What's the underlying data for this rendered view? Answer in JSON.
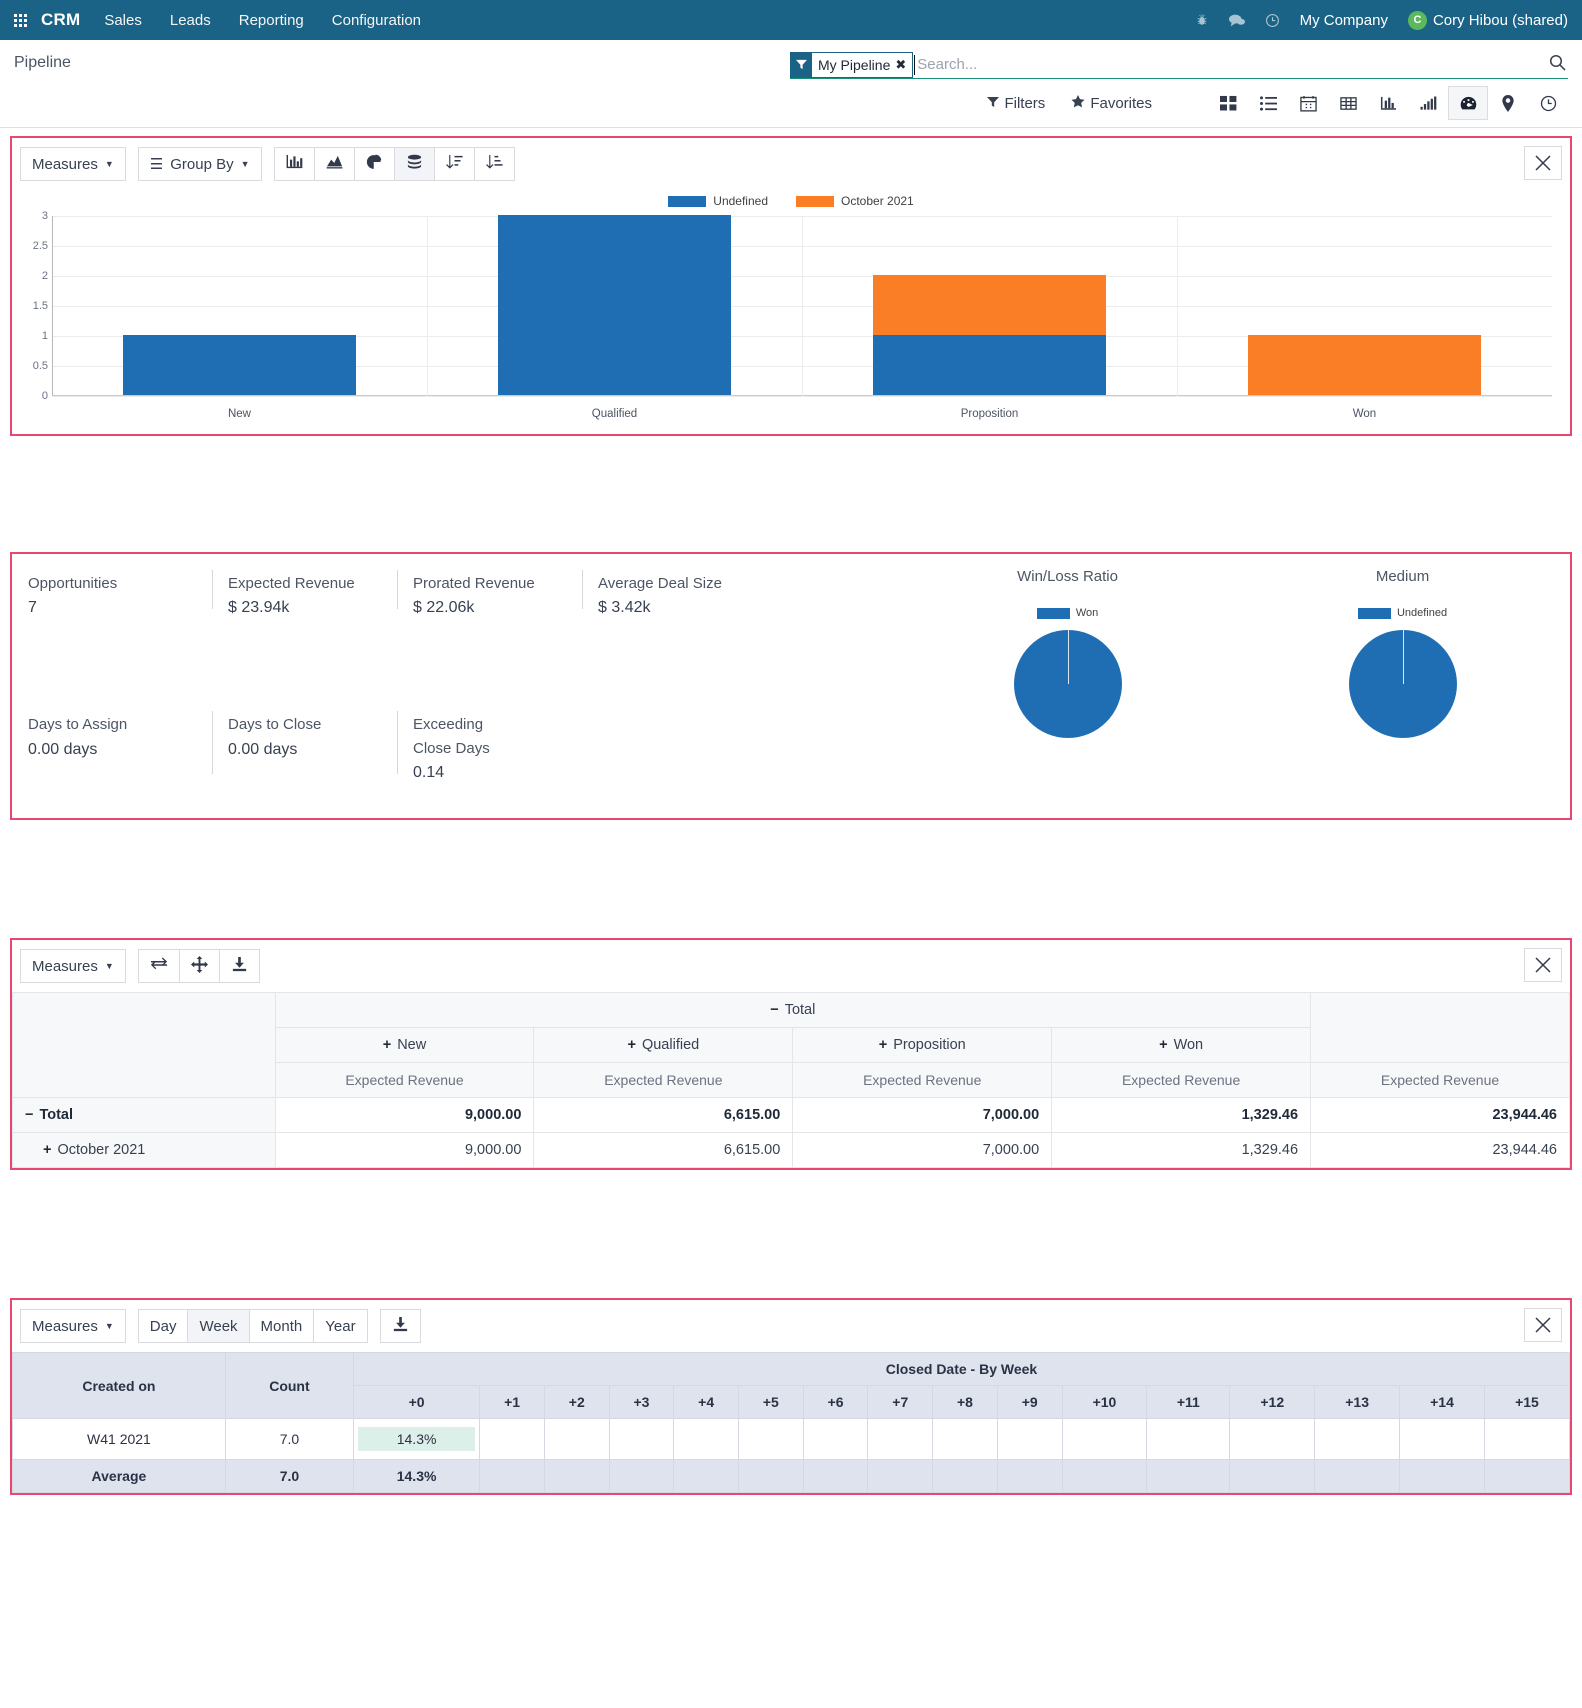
{
  "navbar": {
    "apps_icon": "grid-apps-icon",
    "brand": "CRM",
    "items": [
      "Sales",
      "Leads",
      "Reporting",
      "Configuration"
    ],
    "icons": [
      "bug-icon",
      "messages-icon",
      "activity-clock-icon"
    ],
    "company": "My Company",
    "user": "Cory Hibou (shared)",
    "avatar_letter": "C",
    "avatar_color": "#5cb85c",
    "bg_color": "#1a6387"
  },
  "control_panel": {
    "title": "Pipeline",
    "facet": {
      "label": "My Pipeline",
      "remove": "✖",
      "icon": "filter-icon"
    },
    "search_placeholder": "Search...",
    "search_value": "",
    "search_icon": "magnifier-icon",
    "filters_label": "Filters",
    "favorites_label": "Favorites",
    "views": [
      {
        "name": "kanban-view",
        "icon": "kanban-icon",
        "active": false
      },
      {
        "name": "list-view",
        "icon": "list-icon",
        "active": false
      },
      {
        "name": "calendar-view",
        "icon": "calendar-icon",
        "active": false
      },
      {
        "name": "pivot-view",
        "icon": "table-icon",
        "active": false
      },
      {
        "name": "graph-view",
        "icon": "bar-chart-icon",
        "active": false
      },
      {
        "name": "cohort-view",
        "icon": "signal-bars-icon",
        "active": false
      },
      {
        "name": "dashboard-view",
        "icon": "dashboard-gauge-icon",
        "active": true
      },
      {
        "name": "map-view",
        "icon": "map-pin-icon",
        "active": false
      },
      {
        "name": "activity-view",
        "icon": "clock-icon",
        "active": false
      }
    ]
  },
  "graph_panel": {
    "measures_label": "Measures",
    "group_by_label": "Group By",
    "buttons": [
      {
        "name": "bar-chart-button",
        "icon": "bar-chart-icon",
        "active": false
      },
      {
        "name": "line-chart-button",
        "icon": "area-chart-icon",
        "active": false
      },
      {
        "name": "pie-chart-button",
        "icon": "pie-chart-icon",
        "active": false
      },
      {
        "name": "stacked-button",
        "icon": "database-stack-icon",
        "active": true
      },
      {
        "name": "sort-descending-button",
        "icon": "sort-desc-icon",
        "active": false
      },
      {
        "name": "sort-ascending-button",
        "icon": "sort-asc-icon",
        "active": false
      }
    ],
    "expand_icon": "expand-icon"
  },
  "chart_data": {
    "type": "bar",
    "stacked": true,
    "title": "",
    "xlabel": "",
    "ylabel": "",
    "categories": [
      "New",
      "Qualified",
      "Proposition",
      "Won"
    ],
    "series": [
      {
        "name": "Undefined",
        "color": "#1f6eb4",
        "values": [
          1,
          3,
          1,
          0
        ]
      },
      {
        "name": "October 2021",
        "color": "#fa7e25",
        "values": [
          0,
          0,
          1,
          1
        ]
      }
    ],
    "ylim": [
      0,
      3
    ],
    "yticks": [
      "0",
      "0.5",
      "1",
      "1.5",
      "2",
      "2.5",
      "3"
    ],
    "grid": true,
    "legend_position": "top"
  },
  "kpi_panel": {
    "cells": [
      {
        "name": "Opportunities",
        "value": "7"
      },
      {
        "name": "Expected Revenue",
        "value": "$ 23.94k"
      },
      {
        "name": "Prorated Revenue",
        "value": "$ 22.06k"
      },
      {
        "name": "Average Deal Size",
        "value": "$ 3.42k"
      },
      {
        "name": "Days to Assign",
        "value": "0.00 days"
      },
      {
        "name": "Days to Close",
        "value": "0.00 days"
      },
      {
        "name": "Exceeding Close Days",
        "value": "0.14"
      }
    ],
    "pies": [
      {
        "title": "Win/Loss Ratio",
        "legend": "Won",
        "color": "#1f6eb4"
      },
      {
        "title": "Medium",
        "legend": "Undefined",
        "color": "#1f6eb4"
      }
    ]
  },
  "pivot_panel": {
    "measures_label": "Measures",
    "buttons": [
      {
        "name": "flip-axis-button",
        "icon": "swap-arrows-icon"
      },
      {
        "name": "expand-all-button",
        "icon": "move-arrows-icon"
      },
      {
        "name": "download-xlsx-button",
        "icon": "download-icon"
      }
    ],
    "expand_icon": "expand-icon",
    "total_header": "Total",
    "col_groups": [
      "New",
      "Qualified",
      "Proposition",
      "Won"
    ],
    "measure_label": "Expected Revenue",
    "rows": [
      {
        "label": "Total",
        "toggle": "−",
        "indent": false,
        "bold": true,
        "values": [
          "9,000.00",
          "6,615.00",
          "7,000.00",
          "1,329.46",
          "23,944.46"
        ]
      },
      {
        "label": "October 2021",
        "toggle": "+",
        "indent": true,
        "bold": false,
        "values": [
          "9,000.00",
          "6,615.00",
          "7,000.00",
          "1,329.46",
          "23,944.46"
        ]
      }
    ]
  },
  "cohort_panel": {
    "measures_label": "Measures",
    "intervals": [
      {
        "label": "Day",
        "active": false
      },
      {
        "label": "Week",
        "active": true
      },
      {
        "label": "Month",
        "active": false
      },
      {
        "label": "Year",
        "active": false
      }
    ],
    "download_icon": "download-icon",
    "expand_icon": "expand-icon",
    "col_created_on": "Created on",
    "col_count": "Count",
    "col_group_title": "Closed Date - By Week",
    "period_headers": [
      "+0",
      "+1",
      "+2",
      "+3",
      "+4",
      "+5",
      "+6",
      "+7",
      "+8",
      "+9",
      "+10",
      "+11",
      "+12",
      "+13",
      "+14",
      "+15"
    ],
    "rows": [
      {
        "label": "W41 2021",
        "count": "7.0",
        "cells": [
          "14.3%",
          "",
          "",
          "",
          "",
          "",
          "",
          "",
          "",
          "",
          "",
          "",
          "",
          "",
          "",
          ""
        ],
        "highlight_index": 0,
        "average": false
      },
      {
        "label": "Average",
        "count": "7.0",
        "cells": [
          "14.3%",
          "",
          "",
          "",
          "",
          "",
          "",
          "",
          "",
          "",
          "",
          "",
          "",
          "",
          "",
          ""
        ],
        "highlight_index": -1,
        "average": true
      }
    ]
  }
}
